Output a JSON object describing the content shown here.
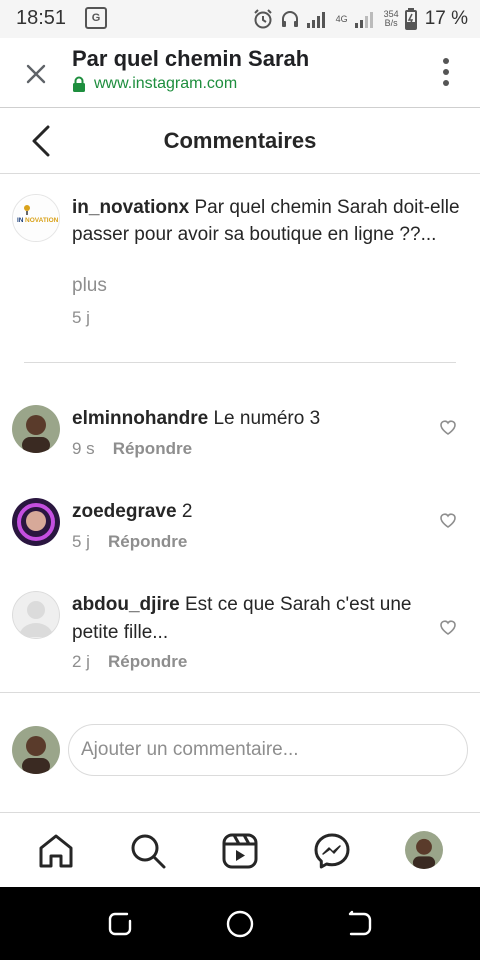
{
  "status_bar": {
    "time": "18:51",
    "translate_badge": "G",
    "network_type": "4G",
    "net_speed_value": "354",
    "net_speed_unit": "B/s",
    "battery_percent": "17 %"
  },
  "browser": {
    "title": "Par quel chemin Sarah",
    "url": "www.instagram.com"
  },
  "screen": {
    "title": "Commentaires"
  },
  "caption": {
    "username": "in_novationx",
    "text": "Par quel chemin Sarah doit-elle passer pour avoir sa boutique en ligne ??...",
    "more_label": "plus",
    "time": "5 j"
  },
  "comments": [
    {
      "username": "elminnohandre",
      "text": "Le numéro 3",
      "time": "9 s",
      "reply_label": "Répondre"
    },
    {
      "username": "zoedegrave",
      "text": "2",
      "time": "5 j",
      "reply_label": "Répondre"
    },
    {
      "username": "abdou_djire",
      "text": "Est ce que Sarah c'est une petite fille...",
      "time": "2 j",
      "reply_label": "Répondre"
    }
  ],
  "compose": {
    "placeholder": "Ajouter un commentaire...",
    "value": ""
  },
  "bottom_nav": {
    "items": [
      "home-icon",
      "search-icon",
      "reels-icon",
      "messenger-icon",
      "profile-avatar"
    ]
  },
  "colors": {
    "username_text": "#262626",
    "secondary_text": "#8e8e8e",
    "url_green": "#1e8e3e",
    "divider": "#dbdbdb"
  }
}
